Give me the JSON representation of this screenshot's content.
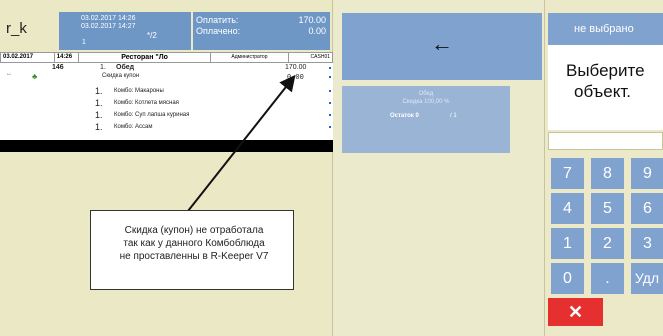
{
  "logo": "r_k",
  "datebox": {
    "line1": "03.02.2017 14:26",
    "line2": "03.02.2017 14:27",
    "one": "1",
    "fraction": "*/2"
  },
  "payment": {
    "pay_label": "Оплатить:",
    "pay_value": "170.00",
    "paid_label": "Оплачено:",
    "paid_value": "0.00"
  },
  "order_header": {
    "date": "03.02.2017",
    "time": "14:26",
    "restaurant": "Ресторан \"Ло",
    "role": "Администратор",
    "station": "CASH01"
  },
  "order": {
    "table": "146",
    "dish_qty": "1.",
    "dish_name": "Обед",
    "dish_price": "170.00",
    "discount_name": "Скидка купон",
    "discount_value": "0.00",
    "components": [
      {
        "qty": "1.",
        "name": "Комбо: Макароны"
      },
      {
        "qty": "1.",
        "name": "Комбо: Котлета мясная"
      },
      {
        "qty": "1.",
        "name": "Комбо: Суп лапша куриная"
      },
      {
        "qty": "1.",
        "name": "Комбо: Ассам"
      }
    ]
  },
  "callout": {
    "line1": "Скидка (купон) не отработала",
    "line2": "так как у данного Комбоблюда",
    "line3": "не проставленны в R-Keeper V7"
  },
  "back_button": "←",
  "item_tile": {
    "name": "Обед",
    "discount": "Скидка 100,00 %",
    "rest_label": "Остаток 0",
    "rest_count": "/ 1"
  },
  "right": {
    "header": "не выбрано",
    "prompt_line1": "Выберите",
    "prompt_line2": "объект.",
    "keys": [
      "7",
      "8",
      "9",
      "4",
      "5",
      "6",
      "1",
      "2",
      "3",
      "0",
      ".",
      "Удл"
    ],
    "cancel": "✕"
  },
  "colors": {
    "accent": "#7fa2cf",
    "cancel": "#e6302f",
    "background": "#ece9c9"
  }
}
